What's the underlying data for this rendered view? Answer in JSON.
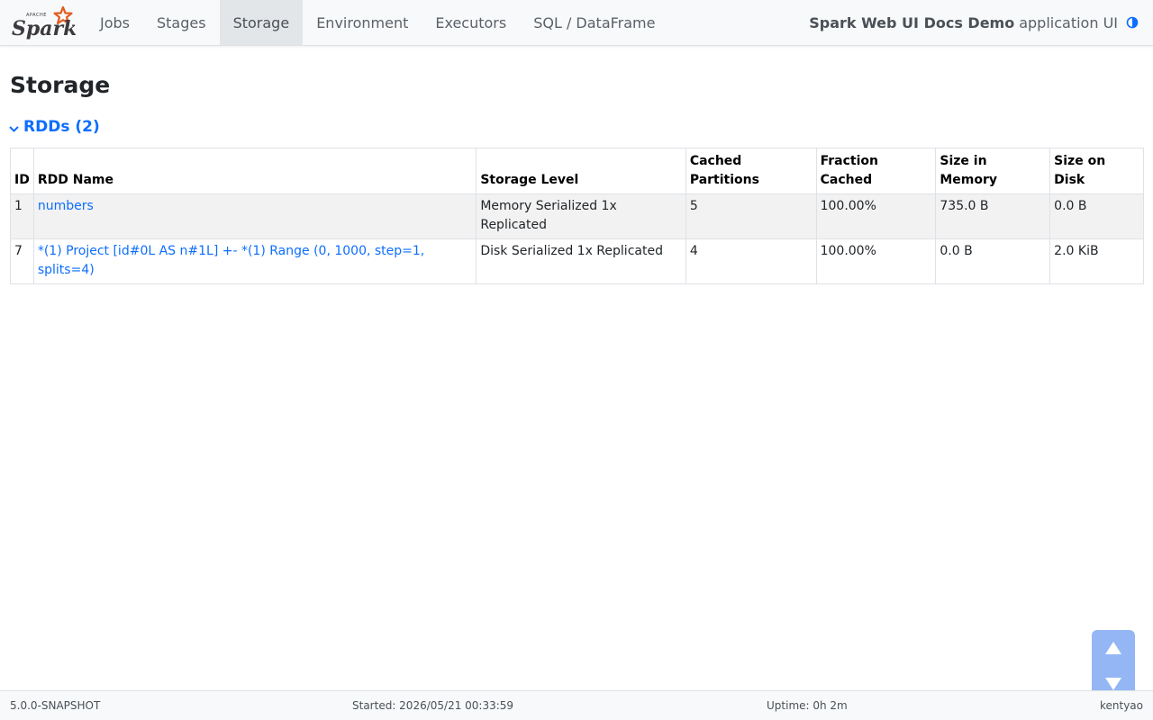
{
  "navbar": {
    "logo_small_text": "APACHE",
    "logo_text": "Spark",
    "tabs": [
      {
        "label": "Jobs",
        "active": false
      },
      {
        "label": "Stages",
        "active": false
      },
      {
        "label": "Storage",
        "active": true
      },
      {
        "label": "Environment",
        "active": false
      },
      {
        "label": "Executors",
        "active": false
      },
      {
        "label": "SQL / DataFrame",
        "active": false
      }
    ],
    "app_name": "Spark Web UI Docs Demo",
    "app_suffix": "application UI",
    "theme_icon": "half-circle-icon"
  },
  "page": {
    "title": "Storage"
  },
  "rdds": {
    "section_label": "RDDs (2)",
    "headers": [
      "ID",
      "RDD Name",
      "Storage Level",
      "Cached Partitions",
      "Fraction Cached",
      "Size in Memory",
      "Size on Disk"
    ],
    "rows": [
      {
        "id": "1",
        "name": "numbers",
        "storage_level": "Memory Serialized 1x Replicated",
        "cached_partitions": "5",
        "fraction_cached": "100.00%",
        "size_in_memory": "735.0 B",
        "size_on_disk": "0.0 B"
      },
      {
        "id": "7",
        "name": "*(1) Project [id#0L AS n#1L] +- *(1) Range (0, 1000, step=1, splits=4)",
        "storage_level": "Disk Serialized 1x Replicated",
        "cached_partitions": "4",
        "fraction_cached": "100.00%",
        "size_in_memory": "0.0 B",
        "size_on_disk": "2.0 KiB"
      }
    ]
  },
  "scroll": {
    "up_icon": "triangle-up-icon",
    "down_icon": "triangle-down-icon"
  },
  "footer": {
    "version": "5.0.0-SNAPSHOT",
    "started": "Started: 2026/05/21 00:33:59",
    "uptime": "Uptime: 0h 2m",
    "user": "kentyao"
  },
  "colors": {
    "link": "#0d6efd",
    "spark_orange": "#e25a1c",
    "scroll_button": "#8fb3f5"
  }
}
